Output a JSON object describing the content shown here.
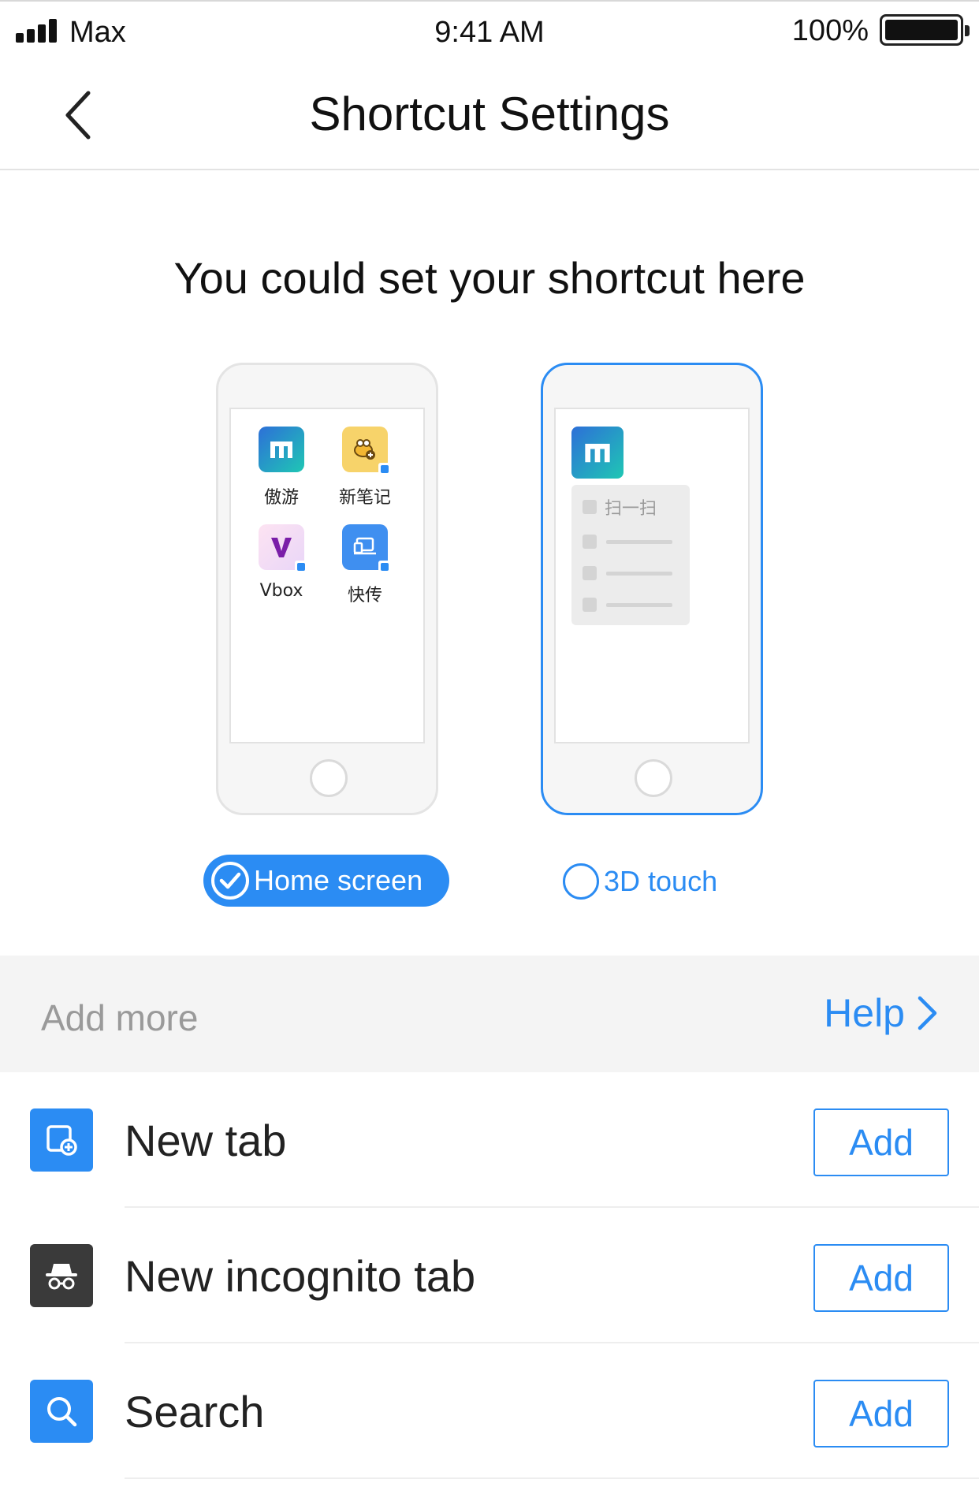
{
  "status_bar": {
    "carrier": "Max",
    "time": "9:41 AM",
    "battery": "100%"
  },
  "nav": {
    "title": "Shortcut Settings"
  },
  "headline": "You could set your shortcut here",
  "home_preview": {
    "apps": [
      {
        "label": "傲游",
        "icon": "maxthon-logo-icon"
      },
      {
        "label": "新笔记",
        "icon": "notes-bee-icon"
      },
      {
        "label": "Vbox",
        "icon": "vbox-icon"
      },
      {
        "label": "快传",
        "icon": "file-transfer-icon"
      }
    ]
  },
  "touch_preview": {
    "menu_first_item": "扫一扫"
  },
  "options": {
    "home_screen": "Home screen",
    "touch_3d": "3D touch",
    "selected": "home_screen"
  },
  "section": {
    "title": "Add more",
    "help": "Help"
  },
  "shortcuts": [
    {
      "label": "New tab",
      "button": "Add",
      "icon": "new-tab-icon",
      "color": "#2b8cf3"
    },
    {
      "label": "New incognito tab",
      "button": "Add",
      "icon": "incognito-icon",
      "color": "#3a3a3a"
    },
    {
      "label": "Search",
      "button": "Add",
      "icon": "search-icon",
      "color": "#2b8cf3"
    }
  ],
  "colors": {
    "accent": "#2b8cf3",
    "section_bg": "#f4f4f4"
  }
}
